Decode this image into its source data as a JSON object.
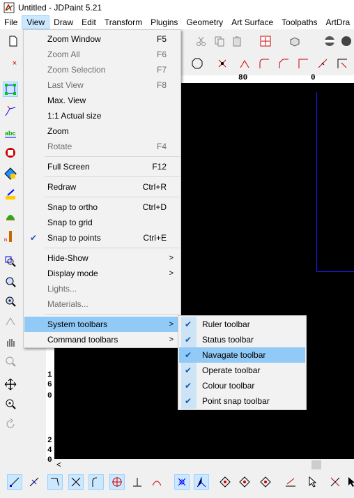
{
  "window": {
    "title": "Untitled - JDPaint 5.21"
  },
  "menubar": [
    {
      "label": "File"
    },
    {
      "label": "View"
    },
    {
      "label": "Draw"
    },
    {
      "label": "Edit"
    },
    {
      "label": "Transform"
    },
    {
      "label": "Plugins"
    },
    {
      "label": "Geometry"
    },
    {
      "label": "Art Surface"
    },
    {
      "label": "Toolpaths"
    },
    {
      "label": "ArtDra"
    }
  ],
  "rulers": {
    "h_label": "80",
    "h_label2": "0",
    "v_labels": [
      "1",
      "6",
      "0",
      "2",
      "4",
      "0"
    ]
  },
  "view_menu": {
    "items": [
      {
        "label": "Zoom Window",
        "shortcut": "F5"
      },
      {
        "label": "Zoom All",
        "shortcut": "F6"
      },
      {
        "label": "Zoom Selection",
        "shortcut": "F7"
      },
      {
        "label": "Last View",
        "shortcut": "F8"
      },
      {
        "label": "Max. View",
        "shortcut": ""
      },
      {
        "label": "1:1 Actual size",
        "shortcut": ""
      },
      {
        "label": "Zoom",
        "shortcut": ""
      },
      {
        "label": "Rotate",
        "shortcut": "F4"
      },
      {
        "label": "Full Screen",
        "shortcut": "F12"
      },
      {
        "label": "Redraw",
        "shortcut": "Ctrl+R"
      },
      {
        "label": "Snap to ortho",
        "shortcut": "Ctrl+D"
      },
      {
        "label": "Snap to grid",
        "shortcut": ""
      },
      {
        "label": "Snap to points",
        "shortcut": "Ctrl+E"
      },
      {
        "label": "Hide-Show",
        "shortcut": ""
      },
      {
        "label": "Display mode",
        "shortcut": ""
      },
      {
        "label": "Lights...",
        "shortcut": ""
      },
      {
        "label": "Materials...",
        "shortcut": ""
      },
      {
        "label": "System toolbars",
        "shortcut": ""
      },
      {
        "label": "Command toolbars",
        "shortcut": ""
      }
    ]
  },
  "system_toolbars_submenu": {
    "items": [
      {
        "label": "Ruler toolbar"
      },
      {
        "label": "Status toolbar"
      },
      {
        "label": "Navagate toolbar"
      },
      {
        "label": "Operate toolbar"
      },
      {
        "label": "Colour toolbar"
      },
      {
        "label": "Point snap toolbar"
      }
    ]
  },
  "colors": {
    "menu_highlight": "#91c9f7",
    "canvas": "#000000",
    "check": "#1a56b8"
  }
}
